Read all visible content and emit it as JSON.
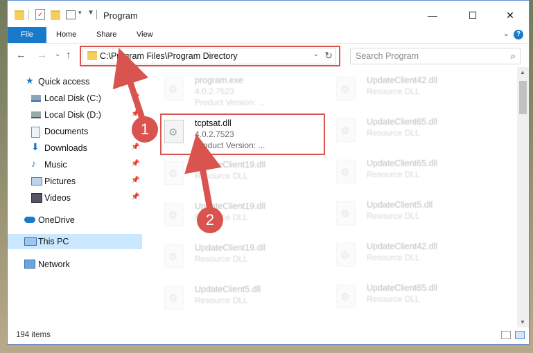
{
  "window": {
    "title": "Program"
  },
  "ribbon": {
    "tabs": [
      "File",
      "Home",
      "Share",
      "View"
    ]
  },
  "address": {
    "path": "C:\\Program Files\\Program Directory"
  },
  "search": {
    "placeholder": "Search Program"
  },
  "sidebar": {
    "items": [
      {
        "label": "Quick access",
        "icon": "star-icon",
        "pinned": false
      },
      {
        "label": "Local Disk (C:)",
        "icon": "drive-icon",
        "pinned": true
      },
      {
        "label": "Local Disk (D:)",
        "icon": "drive-icon",
        "pinned": true
      },
      {
        "label": "Documents",
        "icon": "documents-icon",
        "pinned": true
      },
      {
        "label": "Downloads",
        "icon": "download-icon",
        "pinned": true
      },
      {
        "label": "Music",
        "icon": "music-icon",
        "pinned": true
      },
      {
        "label": "Pictures",
        "icon": "pictures-icon",
        "pinned": true
      },
      {
        "label": "Videos",
        "icon": "videos-icon",
        "pinned": true
      },
      {
        "label": "OneDrive",
        "icon": "cloud-icon",
        "pinned": false
      },
      {
        "label": "This PC",
        "icon": "computer-icon",
        "pinned": false,
        "selected": true
      },
      {
        "label": "Network",
        "icon": "network-icon",
        "pinned": false
      }
    ]
  },
  "files": {
    "left": [
      {
        "name": "program.exe",
        "line1": "4.0.2.7523",
        "line2": "Product Version:      ..."
      },
      {
        "name": "tcptsat.dll",
        "line1": "4.0.2.7523",
        "line2": "Product Version:      ..."
      },
      {
        "name": "UpdateClient19.dll",
        "line1": "Resource DLL"
      },
      {
        "name": "UpdateClient19.dll",
        "line1": "Resource DLL"
      },
      {
        "name": "UpdateClient19.dll",
        "line1": "Resource DLL"
      },
      {
        "name": "UpdateClient5.dll",
        "line1": "Resource DLL"
      }
    ],
    "right": [
      {
        "name": "UpdateClient42.dll",
        "line1": "Resource DLL"
      },
      {
        "name": "UpdateClient65.dll",
        "line1": "Resource DLL"
      },
      {
        "name": "UpdateClient65.dll",
        "line1": "Resource DLL"
      },
      {
        "name": "UpdateClient5.dll",
        "line1": "Resource DLL"
      },
      {
        "name": "UpdateClient42.dll",
        "line1": "Resource DLL"
      },
      {
        "name": "UpdateClient65.dll",
        "line1": "Resource DLL"
      }
    ]
  },
  "status": {
    "count": "194 items"
  },
  "annotations": {
    "step1": "1",
    "step2": "2"
  },
  "colors": {
    "accent": "#1979ca",
    "highlight": "#d9534f",
    "selection": "#cce8ff"
  }
}
